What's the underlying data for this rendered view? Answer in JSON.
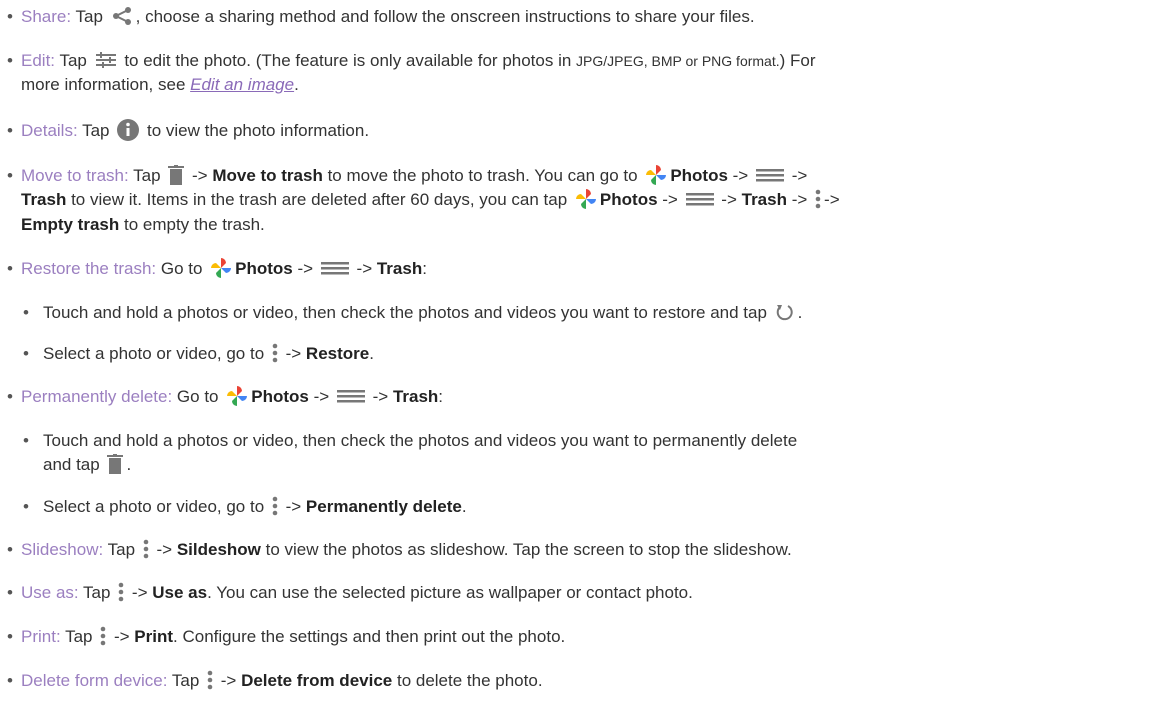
{
  "items": [
    {
      "label": "Share:",
      "t1": " Tap ",
      "t2": ", choose a sharing method and follow the onscreen instructions to share your files."
    },
    {
      "label": "Edit:",
      "t1": " Tap ",
      "t2": " to edit the photo. (The feature is only available for photos in ",
      "fmt": "JPG/JPEG, BMP or PNG format.",
      "t3": ") For",
      "line2a": "more information, see ",
      "link": "Edit an image",
      "line2b": "."
    },
    {
      "label": "Details:",
      "t1": " Tap ",
      "t2": " to view the photo information."
    },
    {
      "label": "Move to trash:",
      "t1": " Tap ",
      "arrow": " -> ",
      "b1": "Move to trash",
      "t2": " to move the photo to trash. You can go to ",
      "photos": "Photos",
      "arrow2": " -> ",
      "arrow3": " ->",
      "line2_b1": "Trash",
      "line2_t1": " to view it. Items in the trash are deleted after 60 days, you can tap ",
      "line2_photos": "Photos",
      "line2_arrow": " -> ",
      "line2_arrow2": " -> ",
      "line2_trash": "Trash",
      "line2_arrow3": " -> ",
      "line2_arrow4": "->",
      "line3_b1": "Empty trash",
      "line3_t1": " to empty the trash."
    },
    {
      "label": "Restore the trash:",
      "t1": " Go to ",
      "photos": "Photos",
      "arrow": " -> ",
      "arrow2": " -> ",
      "trash": "Trash",
      "colon": ":"
    },
    {
      "sub": "Touch and hold a photos or video, then check the photos and videos you want to restore and tap ",
      "end": "."
    },
    {
      "sub": "Select a photo or video, go to ",
      "arrow": " -> ",
      "bold": "Restore",
      "end": "."
    },
    {
      "label": "Permanently delete:",
      "t1": " Go to ",
      "photos": "Photos",
      "arrow": " -> ",
      "arrow2": " -> ",
      "trash": "Trash",
      "colon": ":"
    },
    {
      "sub": "Touch and hold a photos or video, then check the photos and videos you want to permanently delete",
      "sub2": "and tap ",
      "end": "."
    },
    {
      "sub": "Select a photo or video, go to ",
      "arrow": " -> ",
      "bold": "Permanently delete",
      "end": "."
    },
    {
      "label": "Slideshow:",
      "t1": " Tap ",
      "arrow": " -> ",
      "bold": "Sildeshow",
      "t2": " to view the photos as slideshow. Tap the screen to stop the slideshow."
    },
    {
      "label": "Use as:",
      "t1": " Tap ",
      "arrow": " -> ",
      "bold": "Use as",
      "t2": ". You can use the selected picture as wallpaper or contact photo."
    },
    {
      "label": "Print:",
      "t1": " Tap ",
      "arrow": " -> ",
      "bold": "Print",
      "t2": ". Configure the settings and then print out the photo."
    },
    {
      "label": "Delete form device:",
      "t1": " Tap ",
      "arrow": " -> ",
      "bold": "Delete from device",
      "t2": " to delete the photo."
    }
  ],
  "colors": {
    "accent": "#9b7fc0",
    "text": "#333333",
    "icon": "#777777"
  },
  "icons": [
    "share-icon",
    "edit-sliders-icon",
    "info-icon",
    "trash-icon",
    "photos-pinwheel-icon",
    "menu-icon",
    "more-vert-icon",
    "restore-icon"
  ]
}
